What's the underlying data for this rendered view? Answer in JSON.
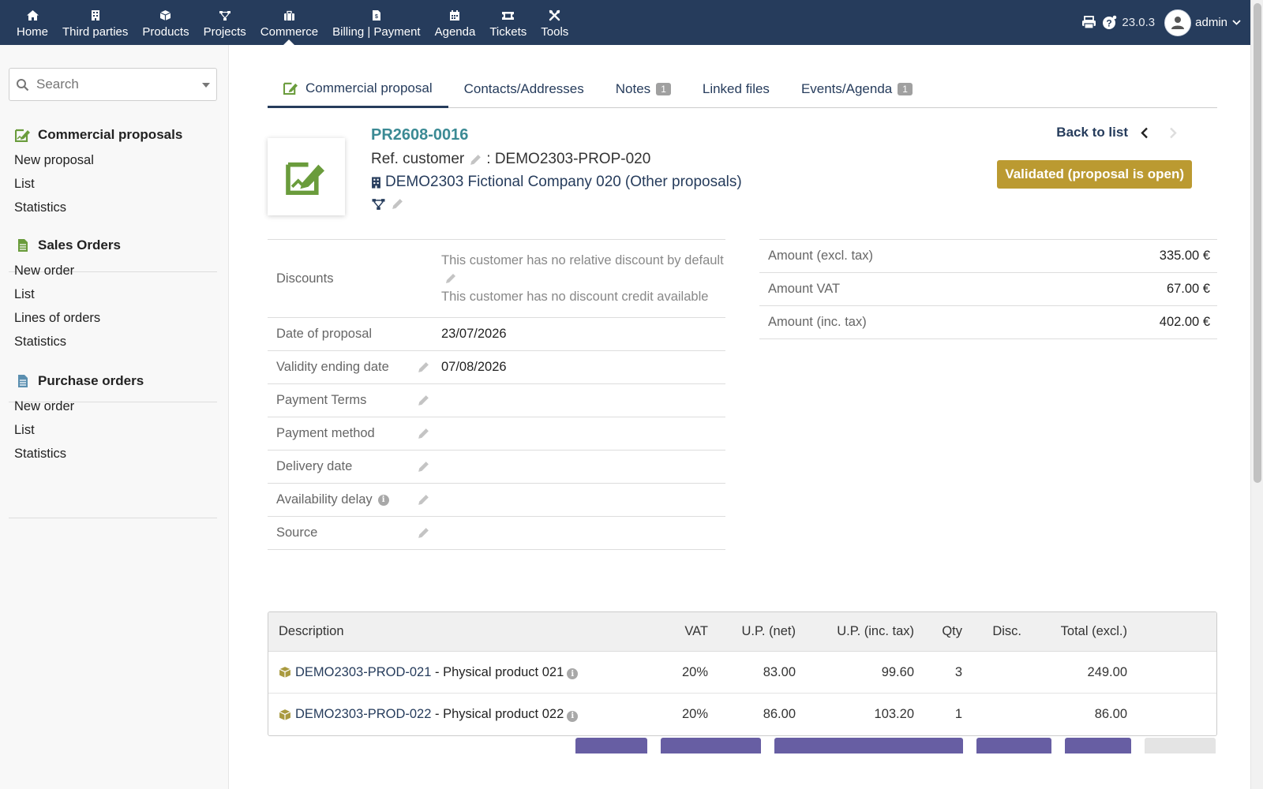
{
  "topnav": {
    "items": [
      {
        "label": "Home",
        "icon": "home-icon"
      },
      {
        "label": "Third parties",
        "icon": "building-icon"
      },
      {
        "label": "Products",
        "icon": "cube-icon"
      },
      {
        "label": "Projects",
        "icon": "project-tree-icon"
      },
      {
        "label": "Commerce",
        "icon": "briefcase-icon"
      },
      {
        "label": "Billing | Payment",
        "icon": "invoice-icon"
      },
      {
        "label": "Agenda",
        "icon": "calendar-icon"
      },
      {
        "label": "Tickets",
        "icon": "ticket-icon"
      },
      {
        "label": "Tools",
        "icon": "tools-icon"
      }
    ],
    "active": "Commerce",
    "version": "23.0.3",
    "user": "admin",
    "bar_color": "#263c5c"
  },
  "search": {
    "placeholder": "Search"
  },
  "leftmenu": {
    "proposals": {
      "title": "Commercial proposals",
      "items": [
        "New proposal",
        "List",
        "Statistics"
      ]
    },
    "orders": {
      "title": "Sales Orders",
      "items": [
        "New order",
        "List",
        "Lines of orders",
        "Statistics"
      ]
    },
    "purchase": {
      "title": "Purchase orders",
      "items": [
        "New order",
        "List",
        "Statistics"
      ]
    }
  },
  "tabs": [
    {
      "label": "Commercial proposal",
      "badge": ""
    },
    {
      "label": "Contacts/Addresses",
      "badge": ""
    },
    {
      "label": "Notes",
      "badge": "1"
    },
    {
      "label": "Linked files",
      "badge": ""
    },
    {
      "label": "Events/Agenda",
      "badge": "1"
    }
  ],
  "header": {
    "ref": "PR2608-0016",
    "ref_customer_label": "Ref. customer",
    "ref_customer_value": ": DEMO2303-PROP-020",
    "thirdparty": "DEMO2303 Fictional Company 020",
    "other_proposals": "Other proposals",
    "back_to_list": "Back to list",
    "status": "Validated (proposal is open)",
    "status_color": "#bb9a31"
  },
  "fields": {
    "discounts_label": "Discounts",
    "discount_relative": "This customer has no relative discount by default",
    "discount_credit": "This customer has no discount credit available",
    "date_label": "Date of proposal",
    "date_value": "23/07/2026",
    "validity_label": "Validity ending date",
    "validity_value": "07/08/2026",
    "payment_terms_label": "Payment Terms",
    "payment_method_label": "Payment method",
    "delivery_label": "Delivery date",
    "availability_label": "Availability delay",
    "source_label": "Source"
  },
  "amounts": {
    "excl_label": "Amount (excl. tax)",
    "excl_value": "335.00 €",
    "vat_label": "Amount VAT",
    "vat_value": "67.00 €",
    "inc_label": "Amount (inc. tax)",
    "inc_value": "402.00 €"
  },
  "lines": {
    "headers": {
      "description": "Description",
      "vat": "VAT",
      "up_net": "U.P. (net)",
      "up_inc": "U.P. (inc. tax)",
      "qty": "Qty",
      "disc": "Disc.",
      "total": "Total (excl.)"
    },
    "rows": [
      {
        "ref": "DEMO2303-PROD-021",
        "label": " - Physical product 021",
        "vat": "20%",
        "up_net": "83.00",
        "up_inc": "99.60",
        "qty": "3",
        "disc": "",
        "total": "249.00"
      },
      {
        "ref": "DEMO2303-PROD-022",
        "label": " - Physical product 022",
        "vat": "20%",
        "up_net": "86.00",
        "up_inc": "103.20",
        "qty": "1",
        "disc": "",
        "total": "86.00"
      }
    ]
  },
  "button_color": "#675ea3"
}
